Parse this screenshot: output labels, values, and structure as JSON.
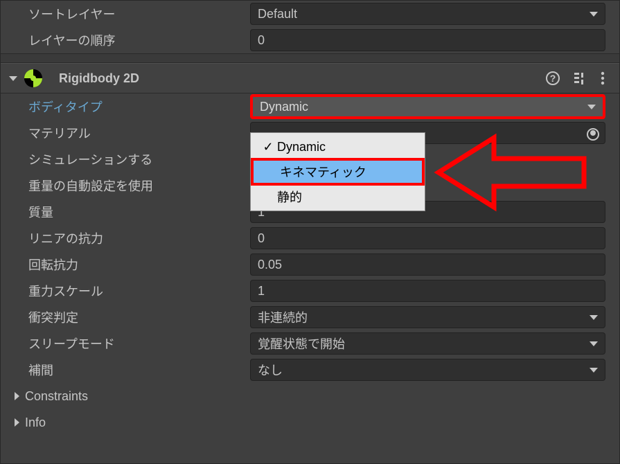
{
  "top": {
    "sorting_layer_label": "ソートレイヤー",
    "sorting_layer_value": "Default",
    "order_label": "レイヤーの順序",
    "order_value": "0"
  },
  "rigidbody": {
    "title": "Rigidbody 2D",
    "body_type_label": "ボディタイプ",
    "body_type_value": "Dynamic",
    "dropdown": {
      "option1": "Dynamic",
      "option2": "キネマティック",
      "option3": "静的"
    },
    "material_label": "マテリアル",
    "simulate_label": "シミュレーションする",
    "auto_mass_label": "重量の自動設定を使用",
    "mass_label": "質量",
    "mass_value": "1",
    "lin_drag_label": "リニアの抗力",
    "lin_drag_value": "0",
    "ang_drag_label": "回転抗力",
    "ang_drag_value": "0.05",
    "grav_label": "重力スケール",
    "grav_value": "1",
    "collision_label": "衝突判定",
    "collision_value": "非連続的",
    "sleep_label": "スリープモード",
    "sleep_value": "覚醒状態で開始",
    "interp_label": "補間",
    "interp_value": "なし",
    "constraints_label": "Constraints",
    "info_label": "Info"
  }
}
